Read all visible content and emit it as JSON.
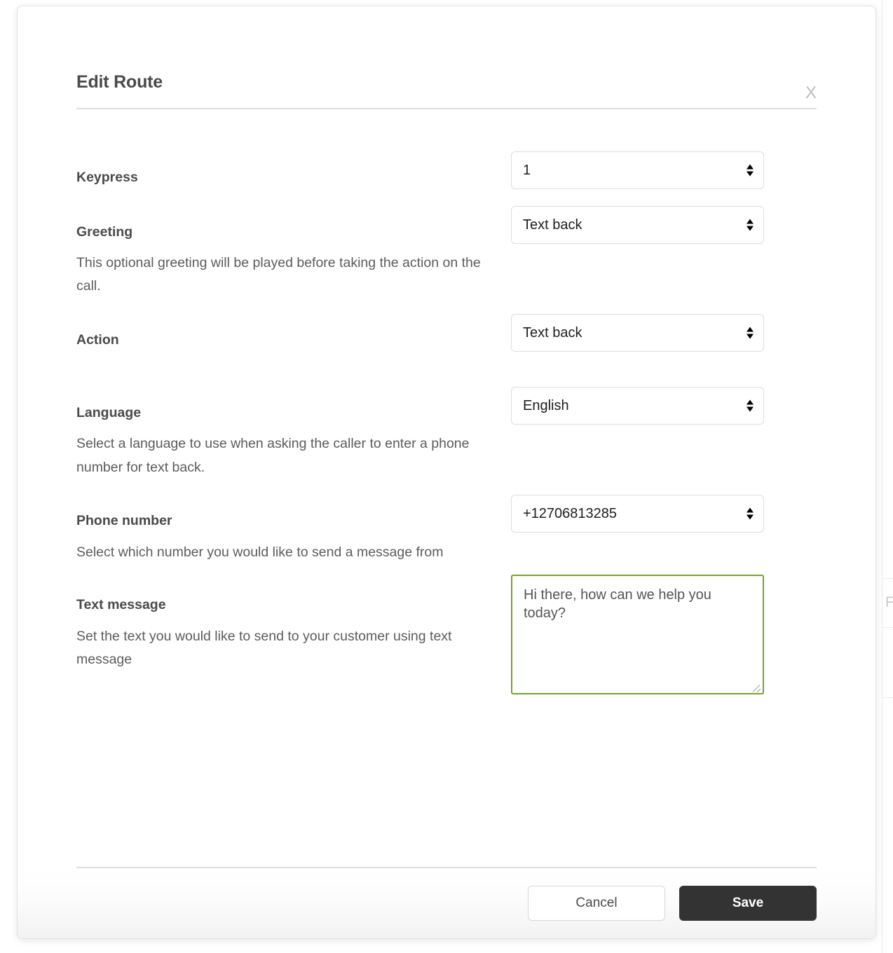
{
  "modal": {
    "title": "Edit Route",
    "close_label": "X",
    "close_icon": "close-x-icon"
  },
  "fields": [
    {
      "label": "Keypress",
      "description": "",
      "control": "select",
      "value": "1"
    },
    {
      "label": "Greeting",
      "description": "This optional greeting will be played before taking the action on the call.",
      "control": "select",
      "value": "Text back"
    },
    {
      "label": "Action",
      "description": "",
      "control": "select",
      "value": "Text back"
    },
    {
      "label": "Language",
      "description": "Select a language to use when asking the caller to enter a phone number for text back.",
      "control": "select",
      "value": "English"
    },
    {
      "label": "Phone number",
      "description": "Select which number you would like to send a message from",
      "control": "select",
      "value": "+12706813285"
    },
    {
      "label": "Text message",
      "description": "Set the text you would like to send to your customer using text message",
      "control": "textarea",
      "value": "Hi there, how can we help you today?"
    }
  ],
  "footer": {
    "cancel_label": "Cancel",
    "save_label": "Save"
  },
  "background": {
    "partial_glyph": "F"
  },
  "colors": {
    "accent_green": "#77a02e",
    "save_button": "#333333",
    "title_text": "#4a4a4a",
    "body_text": "#5c5c5c",
    "border": "#dedede"
  }
}
